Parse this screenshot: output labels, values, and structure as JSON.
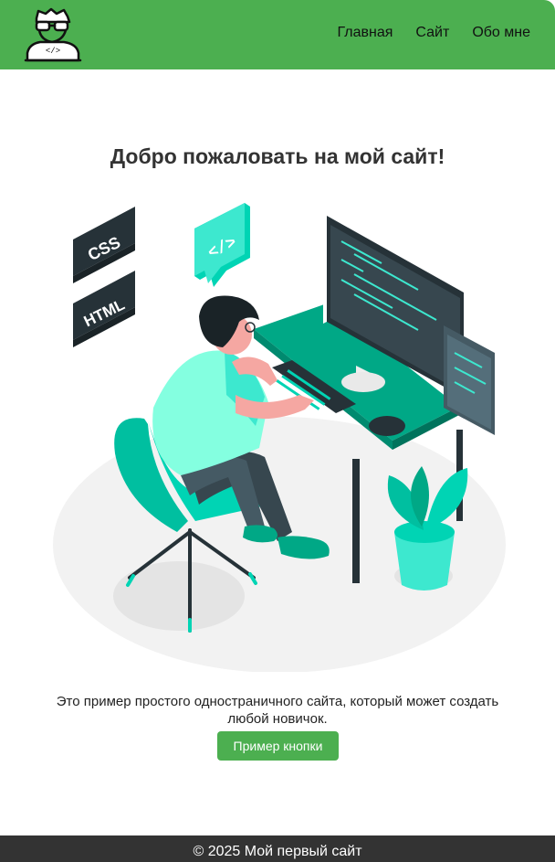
{
  "header": {
    "logo": "developer-avatar-icon",
    "nav": [
      {
        "label": "Главная"
      },
      {
        "label": "Сайт"
      },
      {
        "label": "Обо мне"
      }
    ]
  },
  "main": {
    "title": "Добро пожаловать на мой сайт!",
    "illustration": {
      "badges": [
        "CSS",
        "HTML"
      ],
      "code_bubble": "</>"
    },
    "description": "Это пример простого одностраничного сайта, который может создать любой новичок.",
    "button_label": "Пример кнопки"
  },
  "footer": {
    "text": "© 2025 Мой первый сайт"
  },
  "colors": {
    "header": "#4caf50",
    "button": "#4caf50",
    "footer": "#333333",
    "accent": "#00d4b4"
  }
}
